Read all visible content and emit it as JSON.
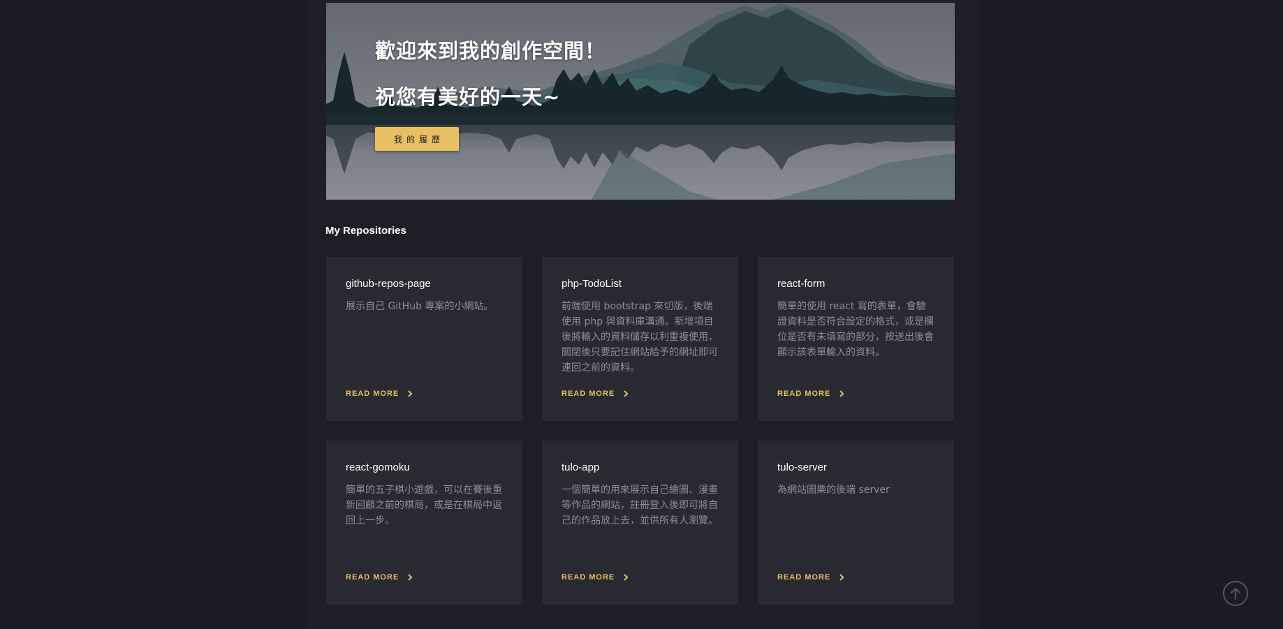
{
  "hero": {
    "line1": "歡迎來到我的創作空間！",
    "line2": "祝您有美好的一天~",
    "resume_button": "我的履歷"
  },
  "section_title": "My Repositories",
  "repos": [
    {
      "name": "github-repos-page",
      "description": "展示自己 GitHub 專案的小網站。",
      "read_more": "READ MORE"
    },
    {
      "name": "php-TodoList",
      "description": "前端使用 bootstrap 來切版，後端使用 php 與資料庫溝通。新增項目後將輸入的資料儲存以利重複使用，關閉後只要記住網站給予的網址即可連回之前的資料。",
      "read_more": "READ MORE"
    },
    {
      "name": "react-form",
      "description": "簡單的使用 react 寫的表單，會驗證資料是否符合設定的格式，或是欄位是否有未填寫的部分，按送出後會顯示該表單輸入的資料。",
      "read_more": "READ MORE"
    },
    {
      "name": "react-gomoku",
      "description": "簡單的五子棋小遊戲，可以在賽後重新回顧之前的棋局，或是在棋局中返回上一步。",
      "read_more": "READ MORE"
    },
    {
      "name": "tulo-app",
      "description": "一個簡單的用來展示自己繪圖、漫畫等作品的網站，註冊登入後即可將自己的作品放上去，並供所有人瀏覽。",
      "read_more": "READ MORE"
    },
    {
      "name": "tulo-server",
      "description": "為網站圖樂的後端 server",
      "read_more": "READ MORE"
    }
  ],
  "colors": {
    "background": "#1c1b24",
    "card": "#292932",
    "accent": "#e8c062",
    "text_muted": "#8d8d96"
  },
  "icons": {
    "read_more": "chevron-right-icon",
    "back_to_top": "arrow-up-circle-icon"
  }
}
